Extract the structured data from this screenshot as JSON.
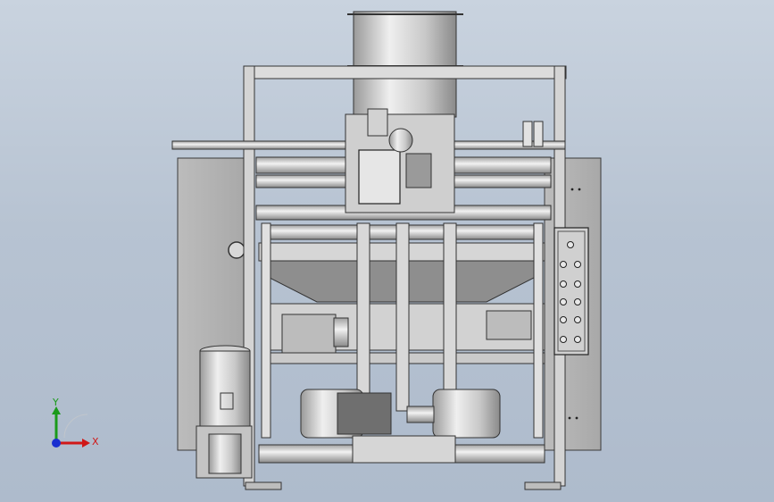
{
  "viewport": {
    "background_top": "#c9d3df",
    "background_bottom": "#aebbcc"
  },
  "model": {
    "description_colors": {
      "metal_light": "#e8e8e8",
      "metal_mid": "#bdbdbd",
      "metal_dark": "#7a7a7a",
      "panel": "#b5b5b5",
      "outline": "#3a3a3a"
    },
    "control_panel_buttons": 14
  },
  "triad": {
    "x_label": "X",
    "y_label": "Y",
    "x_color": "#d01818",
    "y_color": "#1a9a1a",
    "z_color": "#1a2fd0"
  }
}
